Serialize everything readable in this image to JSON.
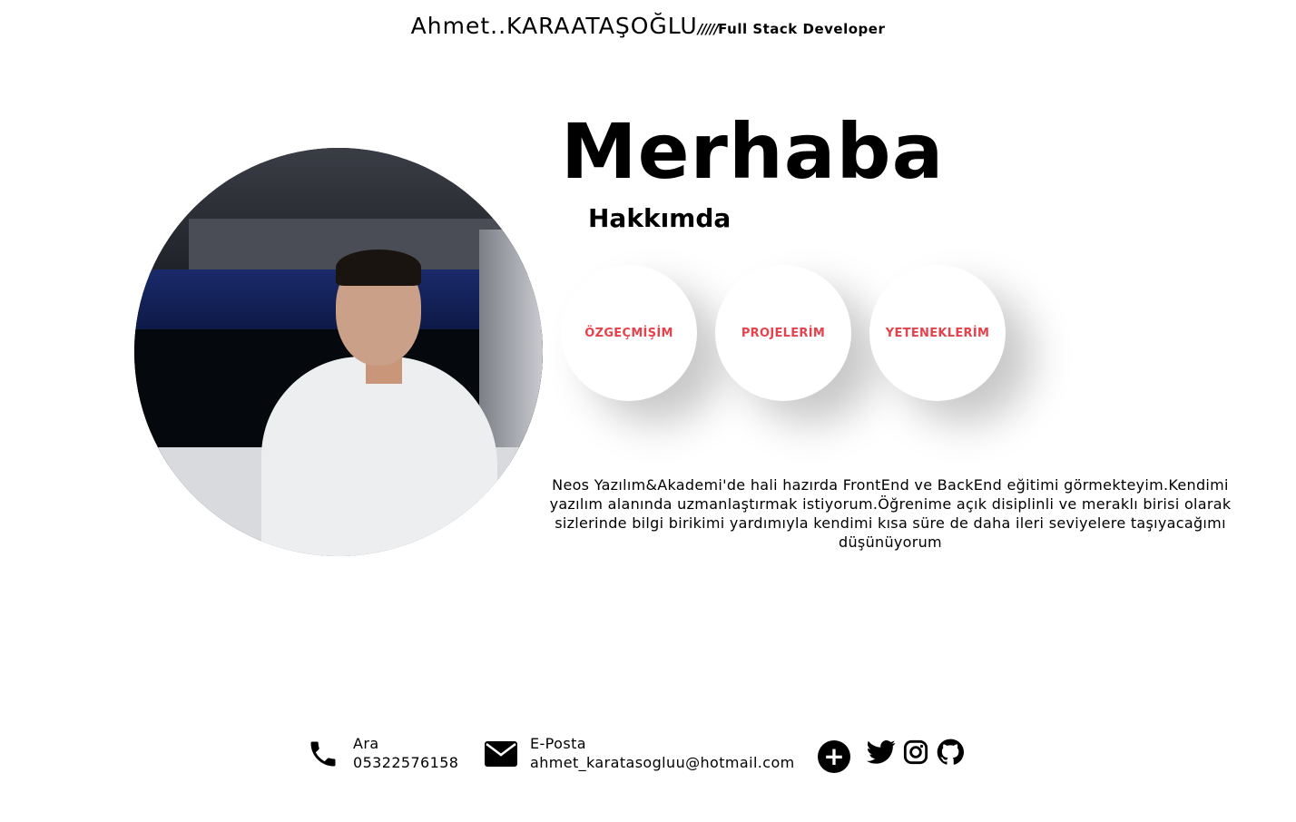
{
  "header": {
    "name": "Ahmet..KARAATAŞOĞLU",
    "separator": "/////",
    "role": "Full Stack Developer"
  },
  "hero": {
    "greeting": "Merhaba",
    "about_link": "Hakkımda",
    "buttons": [
      "ÖZGEÇMİŞİM",
      "PROJELERİM",
      "YETENEKLERİM"
    ],
    "button_color": "#e5424d",
    "bio": "Neos Yazılım&Akademi'de hali hazırda FrontEnd ve BackEnd eğitimi görmekteyim.Kendimi yazılım alanında uzmanlaştırmak istiyorum.Öğrenime açık disiplinli ve meraklı birisi olarak sizlerinde bilgi birikimi yardımıyla kendimi kısa süre de daha ileri seviyelere taşıyacağımı düşünüyorum"
  },
  "contact": {
    "phone_label": "Ara",
    "phone_value": "05322576158",
    "email_label": "E-Posta",
    "email_value": "ahmet_karatasogluu@hotmail.com",
    "plus_symbol": "+"
  },
  "icons": {
    "phone": "phone-icon",
    "mail": "envelope-icon",
    "plus": "plus-circle-icon",
    "social": [
      "twitter-icon",
      "instagram-icon",
      "github-icon"
    ]
  }
}
